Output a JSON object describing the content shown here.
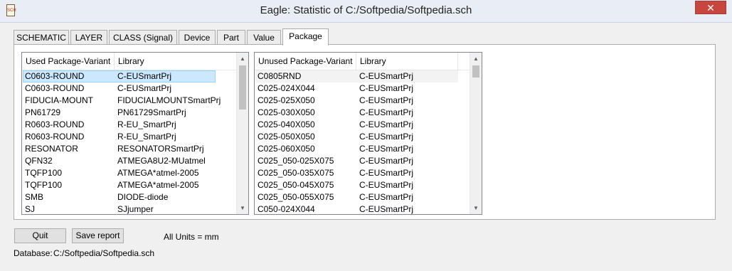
{
  "window": {
    "title": "Eagle: Statistic of C:/Softpedia/Softpedia.sch",
    "icon": "document-icon",
    "close_glyph": "✕",
    "icon_text": "SCH"
  },
  "tabs": [
    {
      "label": "SCHEMATIC",
      "active": false
    },
    {
      "label": "LAYER",
      "active": false
    },
    {
      "label": "CLASS (Signal)",
      "active": false
    },
    {
      "label": "Device",
      "active": false
    },
    {
      "label": "Part",
      "active": false
    },
    {
      "label": "Value",
      "active": false
    },
    {
      "label": "Package",
      "active": true
    }
  ],
  "used": {
    "headers": [
      "Used Package-Variant",
      "Library"
    ],
    "rows": [
      [
        "C0603-ROUND",
        "C-EUSmartPrj"
      ],
      [
        "C0603-ROUND",
        "C-EUSmartPrj"
      ],
      [
        "FIDUCIA-MOUNT",
        "FIDUCIALMOUNTSmartPrj"
      ],
      [
        "PN61729",
        "PN61729SmartPrj"
      ],
      [
        "R0603-ROUND",
        "R-EU_SmartPrj"
      ],
      [
        "R0603-ROUND",
        "R-EU_SmartPrj"
      ],
      [
        "RESONATOR",
        "RESONATORSmartPrj"
      ],
      [
        "QFN32",
        "ATMEGA8U2-MUatmel"
      ],
      [
        "TQFP100",
        "ATMEGA*atmel-2005"
      ],
      [
        "TQFP100",
        "ATMEGA*atmel-2005"
      ],
      [
        "SMB",
        "DIODE-diode"
      ],
      [
        "SJ",
        "SJjumper"
      ]
    ]
  },
  "unused": {
    "headers": [
      "Unused Package-Variant",
      "Library"
    ],
    "rows": [
      [
        "C0805RND",
        "C-EUSmartPrj"
      ],
      [
        "C025-024X044",
        "C-EUSmartPrj"
      ],
      [
        "C025-025X050",
        "C-EUSmartPrj"
      ],
      [
        "C025-030X050",
        "C-EUSmartPrj"
      ],
      [
        "C025-040X050",
        "C-EUSmartPrj"
      ],
      [
        "C025-050X050",
        "C-EUSmartPrj"
      ],
      [
        "C025-060X050",
        "C-EUSmartPrj"
      ],
      [
        "C025_050-025X075",
        "C-EUSmartPrj"
      ],
      [
        "C025_050-035X075",
        "C-EUSmartPrj"
      ],
      [
        "C025_050-045X075",
        "C-EUSmartPrj"
      ],
      [
        "C025_050-055X075",
        "C-EUSmartPrj"
      ],
      [
        "C050-024X044",
        "C-EUSmartPrj"
      ]
    ]
  },
  "buttons": {
    "quit": "Quit",
    "save_report": "Save report"
  },
  "units_text": "All Units = mm",
  "database": {
    "label": "Database:",
    "path": "C:/Softpedia/Softpedia.sch"
  },
  "scroll": {
    "up_glyph": "▲",
    "down_glyph": "▼"
  }
}
